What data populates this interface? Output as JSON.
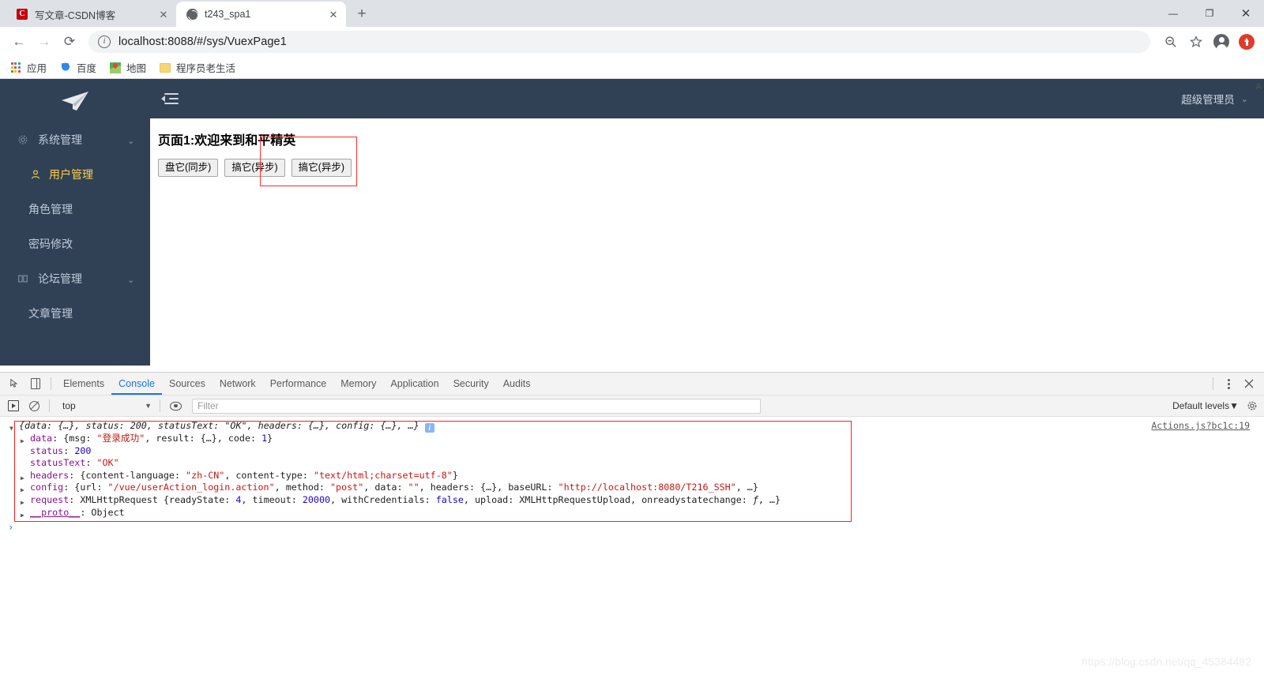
{
  "browser": {
    "tabs": [
      {
        "title": "写文章-CSDN博客",
        "favicon": "csdn-icon",
        "active": false,
        "close_label": "✕"
      },
      {
        "title": "t243_spa1",
        "favicon": "globe-icon",
        "active": true,
        "close_label": "✕"
      }
    ],
    "new_tab_label": "+",
    "window_controls": {
      "minimize": "—",
      "maximize": "❐",
      "close": "✕"
    },
    "nav": {
      "back": "←",
      "forward": "→",
      "reload": "⟳"
    },
    "omnibox": {
      "url": "localhost:8088/#/sys/VuexPage1",
      "info_icon": "i"
    },
    "toolbar_icons": [
      "zoom-out-icon",
      "bookmark-star-icon",
      "profile-avatar-icon",
      "update-icon"
    ],
    "bookmarks": [
      {
        "label": "应用",
        "icon": "apps-grid-icon"
      },
      {
        "label": "百度",
        "icon": "baidu-icon"
      },
      {
        "label": "地图",
        "icon": "google-maps-icon"
      },
      {
        "label": "程序员老生活",
        "icon": "folder-icon"
      }
    ]
  },
  "app": {
    "sidebar": {
      "logo": "paper-plane-logo",
      "groups": [
        {
          "label": "系统管理",
          "icon": "gear-icon",
          "chevron": "⌃",
          "items": [
            {
              "label": "用户管理",
              "icon": "user-icon",
              "active": true
            },
            {
              "label": "角色管理",
              "icon": "",
              "active": false
            },
            {
              "label": "密码修改",
              "icon": "",
              "active": false
            }
          ]
        },
        {
          "label": "论坛管理",
          "icon": "book-icon",
          "chevron": "⌃",
          "items": [
            {
              "label": "文章管理",
              "icon": "",
              "active": false
            }
          ]
        }
      ]
    },
    "header": {
      "fold_icon": "collapse-sidebar-icon",
      "user_label": "超级管理员",
      "user_chevron": "⌄"
    },
    "content": {
      "page_title": "页面1:欢迎来到和平精英",
      "buttons": [
        {
          "label": "盘它(同步)"
        },
        {
          "label": "搞它(异步)"
        },
        {
          "label": "搞它(异步)"
        }
      ],
      "scroll_letter": "A"
    }
  },
  "devtools": {
    "left_icons": [
      "inspect-element-icon",
      "device-toolbar-icon"
    ],
    "tabs": [
      {
        "label": "Elements",
        "active": false
      },
      {
        "label": "Console",
        "active": true
      },
      {
        "label": "Sources",
        "active": false
      },
      {
        "label": "Network",
        "active": false
      },
      {
        "label": "Performance",
        "active": false
      },
      {
        "label": "Memory",
        "active": false
      },
      {
        "label": "Application",
        "active": false
      },
      {
        "label": "Security",
        "active": false
      },
      {
        "label": "Audits",
        "active": false
      }
    ],
    "right_icons": [
      "more-options-icon",
      "close-devtools-icon"
    ],
    "filterbar": {
      "execute_icon": "execution-context-icon",
      "clear_icon": "clear-console-icon",
      "context": "top",
      "context_chevron": "▼",
      "eye_icon": "live-expression-icon",
      "filter_placeholder": "Filter",
      "levels_label": "Default levels",
      "levels_chevron": "▼",
      "settings_icon": "gear-icon"
    },
    "console": {
      "source_link": "Actions.js?bc1c:19",
      "info_badge": "i",
      "prompt": "›",
      "rows": [
        {
          "indent": 0,
          "triangle": "▼",
          "segments": [
            {
              "t": "{data: {…}, status: ",
              "c": "ital"
            },
            {
              "t": "200",
              "c": "num-ital"
            },
            {
              "t": ", statusText: ",
              "c": "ital"
            },
            {
              "t": "\"OK\"",
              "c": "str-ital"
            },
            {
              "t": ", headers: {…}, config: {…}, …}",
              "c": "ital"
            }
          ]
        },
        {
          "indent": 1,
          "triangle": "▶",
          "segments": [
            {
              "t": "data",
              "c": "key"
            },
            {
              "t": ": {msg: ",
              "c": "plain"
            },
            {
              "t": "\"登录成功\"",
              "c": "str"
            },
            {
              "t": ", result: {…}, code: ",
              "c": "plain"
            },
            {
              "t": "1",
              "c": "num"
            },
            {
              "t": "}",
              "c": "plain"
            }
          ]
        },
        {
          "indent": 1,
          "triangle": "",
          "segments": [
            {
              "t": "status",
              "c": "key"
            },
            {
              "t": ": ",
              "c": "plain"
            },
            {
              "t": "200",
              "c": "num"
            }
          ]
        },
        {
          "indent": 1,
          "triangle": "",
          "segments": [
            {
              "t": "statusText",
              "c": "key"
            },
            {
              "t": ": ",
              "c": "plain"
            },
            {
              "t": "\"OK\"",
              "c": "str"
            }
          ]
        },
        {
          "indent": 1,
          "triangle": "▶",
          "segments": [
            {
              "t": "headers",
              "c": "key"
            },
            {
              "t": ": {content-language: ",
              "c": "plain"
            },
            {
              "t": "\"zh-CN\"",
              "c": "str"
            },
            {
              "t": ", content-type: ",
              "c": "plain"
            },
            {
              "t": "\"text/html;charset=utf-8\"",
              "c": "str"
            },
            {
              "t": "}",
              "c": "plain"
            }
          ]
        },
        {
          "indent": 1,
          "triangle": "▶",
          "segments": [
            {
              "t": "config",
              "c": "key"
            },
            {
              "t": ": {url: ",
              "c": "plain"
            },
            {
              "t": "\"/vue/userAction_login.action\"",
              "c": "str"
            },
            {
              "t": ", method: ",
              "c": "plain"
            },
            {
              "t": "\"post\"",
              "c": "str"
            },
            {
              "t": ", data: ",
              "c": "plain"
            },
            {
              "t": "\"\"",
              "c": "str"
            },
            {
              "t": ", headers: {…}, baseURL: ",
              "c": "plain"
            },
            {
              "t": "\"http://localhost:8080/T216_SSH\"",
              "c": "str"
            },
            {
              "t": ", …}",
              "c": "plain"
            }
          ]
        },
        {
          "indent": 1,
          "triangle": "▶",
          "segments": [
            {
              "t": "request",
              "c": "key"
            },
            {
              "t": ": XMLHttpRequest {readyState: ",
              "c": "plain"
            },
            {
              "t": "4",
              "c": "num"
            },
            {
              "t": ", timeout: ",
              "c": "plain"
            },
            {
              "t": "20000",
              "c": "num"
            },
            {
              "t": ", withCredentials: ",
              "c": "plain"
            },
            {
              "t": "false",
              "c": "num"
            },
            {
              "t": ", upload: XMLHttpRequestUpload, onreadystatechange: ",
              "c": "plain"
            },
            {
              "t": "ƒ",
              "c": "func"
            },
            {
              "t": ", …}",
              "c": "plain"
            }
          ]
        },
        {
          "indent": 1,
          "triangle": "▶",
          "segments": [
            {
              "t": "__proto__",
              "c": "key-underline"
            },
            {
              "t": ": Object",
              "c": "plain"
            }
          ]
        }
      ]
    }
  },
  "watermark": "https://blog.csdn.net/qq_45384482",
  "colors": {
    "sidebar_bg": "#304156",
    "active_menu": "#ffd04b",
    "menu_text": "#bfcbd9",
    "devtools_accent": "#1a73e8",
    "highlight_box": "#ff2020",
    "tabstrip_bg": "#dee1e6"
  }
}
